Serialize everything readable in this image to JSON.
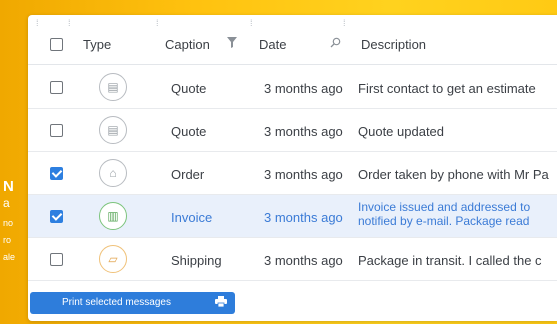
{
  "side_text": {
    "big": "N",
    "mid": "a",
    "lines": [
      "no",
      "ro",
      "ale"
    ]
  },
  "header": {
    "type": "Type",
    "caption": "Caption",
    "date": "Date",
    "description": "Description"
  },
  "rows": [
    {
      "checked": false,
      "type_icon": "document-icon",
      "caption": "Quote",
      "date": "3 months ago",
      "description": "First contact to get an estimate",
      "selected": false
    },
    {
      "checked": false,
      "type_icon": "document-icon",
      "caption": "Quote",
      "date": "3 months ago",
      "description": "Quote updated",
      "selected": false
    },
    {
      "checked": true,
      "type_icon": "order-tag-icon",
      "caption": "Order",
      "date": "3 months ago",
      "description": "Order taken by phone with Mr Pa",
      "selected": false
    },
    {
      "checked": true,
      "type_icon": "invoice-icon",
      "caption": "Invoice",
      "date": "3 months ago",
      "description_line1": "Invoice issued and addressed to",
      "description_line2": "notified by e-mail. Package read",
      "selected": true
    },
    {
      "checked": false,
      "type_icon": "shipping-icon",
      "caption": "Shipping",
      "date": "3 months ago",
      "description": "Package in transit. I called the c",
      "selected": false
    }
  ],
  "print_button": {
    "label": "Print selected messages",
    "icon": "printer-icon"
  },
  "colors": {
    "accent": "#2e7ddb",
    "selected_row": "#e9f0fb",
    "background": "#ffc20f"
  }
}
